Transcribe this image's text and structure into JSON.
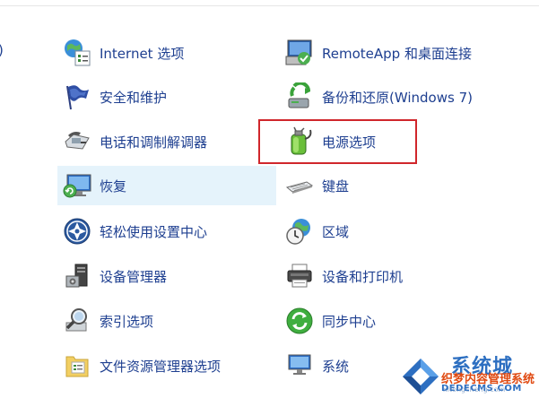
{
  "left_fragment": ")",
  "items": [
    {
      "label": "Internet 选项",
      "icon": "internet-options-icon"
    },
    {
      "label": "RemoteApp 和桌面连接",
      "icon": "remoteapp-icon"
    },
    {
      "label": "安全和维护",
      "icon": "security-flag-icon"
    },
    {
      "label": "备份和还原(Windows 7)",
      "icon": "backup-restore-icon"
    },
    {
      "label": "电话和调制解调器",
      "icon": "phone-modem-icon"
    },
    {
      "label": "电源选项",
      "icon": "power-options-icon"
    },
    {
      "label": "恢复",
      "icon": "recovery-icon"
    },
    {
      "label": "键盘",
      "icon": "keyboard-icon"
    },
    {
      "label": "轻松使用设置中心",
      "icon": "ease-of-access-icon"
    },
    {
      "label": "区域",
      "icon": "region-icon"
    },
    {
      "label": "设备管理器",
      "icon": "device-manager-icon"
    },
    {
      "label": "设备和打印机",
      "icon": "printer-icon"
    },
    {
      "label": "索引选项",
      "icon": "indexing-icon"
    },
    {
      "label": "同步中心",
      "icon": "sync-center-icon"
    },
    {
      "label": "文件资源管理器选项",
      "icon": "folder-options-icon"
    },
    {
      "label": "系统",
      "icon": "system-icon"
    }
  ],
  "hovered_item": "恢复",
  "highlighted_item": "电源选项",
  "colors": {
    "link": "#1e3f90",
    "hover": "#e5f3fb",
    "highlight_border": "#d0262b"
  },
  "watermark": {
    "logo_text": "系统城",
    "site_name": "织梦内容管理系统",
    "url": "DEDECMS.COM",
    "url2": "xitongcheng.com"
  }
}
